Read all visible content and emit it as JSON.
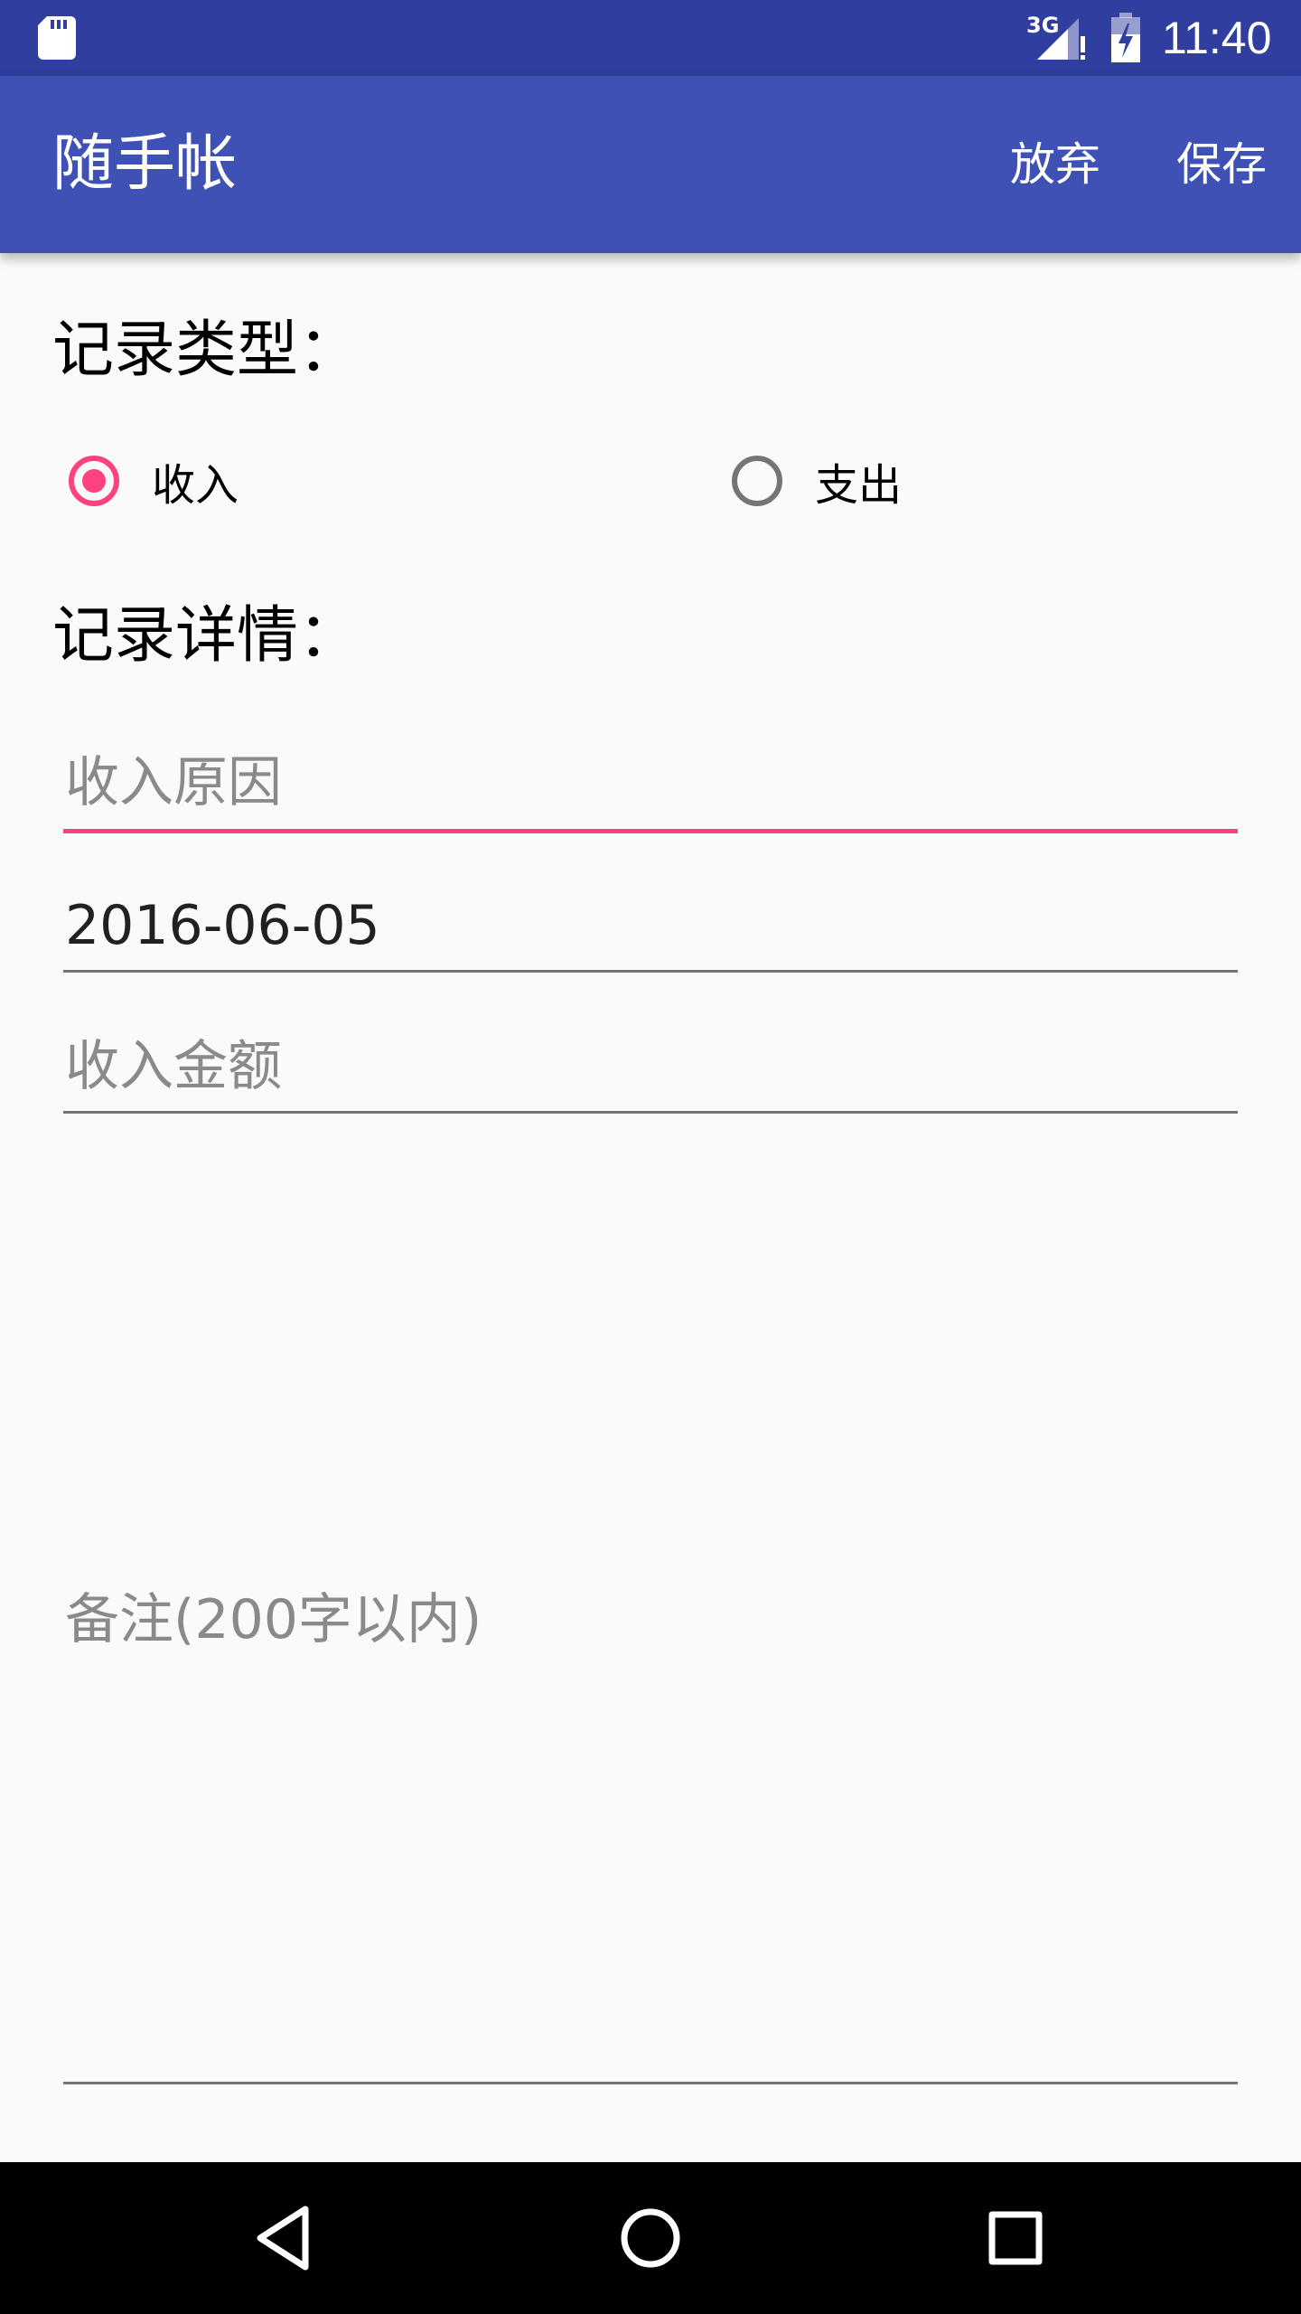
{
  "status_bar": {
    "time": "11:40",
    "network": "3G"
  },
  "app_bar": {
    "title": "随手帐",
    "actions": {
      "discard": "放弃",
      "save": "保存"
    }
  },
  "record_type": {
    "title": "记录类型：",
    "options": [
      {
        "label": "收入",
        "checked": true
      },
      {
        "label": "支出",
        "checked": false
      }
    ]
  },
  "record_detail": {
    "title": "记录详情：",
    "reason": {
      "placeholder": "收入原因",
      "value": ""
    },
    "date": {
      "value": "2016-06-05"
    },
    "amount": {
      "placeholder": "收入金额",
      "value": ""
    },
    "note": {
      "placeholder": "备注(200字以内)",
      "value": ""
    }
  },
  "colors": {
    "status_bar": "#303F9F",
    "app_bar": "#3F51B5",
    "accent": "#FF4081",
    "background": "#FAFAFA"
  },
  "icons": {
    "status": [
      "sd-card-icon",
      "signal-icon",
      "battery-charging-icon"
    ],
    "nav": [
      "back-icon",
      "home-icon",
      "recents-icon"
    ]
  }
}
